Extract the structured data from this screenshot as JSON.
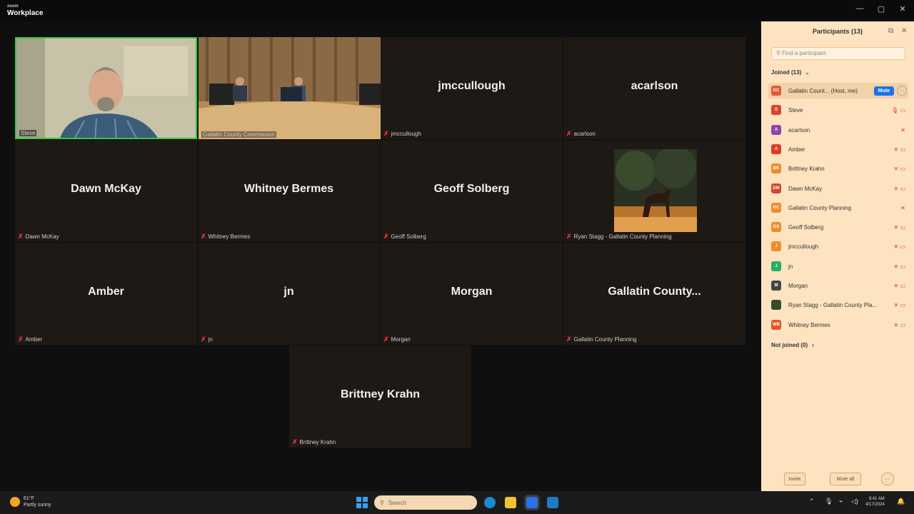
{
  "app": {
    "logo_top": "zoom",
    "logo_bottom": "Workplace"
  },
  "window_controls": {
    "minimize": "—",
    "maximize": "▢",
    "close": "✕"
  },
  "tiles": [
    {
      "name": "",
      "label": "Steve",
      "kind": "video-steve"
    },
    {
      "name": "",
      "label": "Gallatin County Commission",
      "kind": "video-room"
    },
    {
      "name": "jmccullough",
      "label": "jmccullough"
    },
    {
      "name": "acarlson",
      "label": "acarlson"
    },
    {
      "name": "Dawn McKay",
      "label": "Dawn McKay"
    },
    {
      "name": "Whitney Bermes",
      "label": "Whitney Bermes"
    },
    {
      "name": "Geoff Solberg",
      "label": "Geoff Solberg"
    },
    {
      "name": "",
      "label": "Ryan Stagg - Gallatin County Planning",
      "kind": "photo-horse"
    },
    {
      "name": "Amber",
      "label": "Amber"
    },
    {
      "name": "jn",
      "label": "jn"
    },
    {
      "name": "Morgan",
      "label": "Morgan"
    },
    {
      "name": "Gallatin County...",
      "label": "Gallatin County Planning"
    },
    {
      "name": "Brittney Krahn",
      "label": "Brittney Krahn"
    }
  ],
  "panel": {
    "title": "Participants (13)",
    "search_placeholder": "Find a participant",
    "joined_label": "Joined (13)",
    "not_joined_label": "Not joined (0)",
    "mute_label": "Mute",
    "invite_label": "Invite",
    "mute_all_label": "Mute all",
    "participants": [
      {
        "initials": "GC",
        "color": "#e05a3a",
        "name": "Gallatin Count... (Host, me)",
        "host": true
      },
      {
        "initials": "S",
        "color": "#d9452b",
        "name": "Steve",
        "icons": "🎙 ▭"
      },
      {
        "initials": "A",
        "color": "#8e44ad",
        "name": "acarlson",
        "icons": "✕"
      },
      {
        "initials": "A",
        "color": "#e03a2a",
        "name": "Amber",
        "icons": "✕ ▭"
      },
      {
        "initials": "BK",
        "color": "#f08c2a",
        "name": "Brittney Krahn",
        "icons": "✕ ▭"
      },
      {
        "initials": "DM",
        "color": "#d9452b",
        "name": "Dawn McKay",
        "icons": "✕ ▭"
      },
      {
        "initials": "GC",
        "color": "#f08c2a",
        "name": "Gallatin County Planning",
        "icons": "✕"
      },
      {
        "initials": "GS",
        "color": "#f08c2a",
        "name": "Geoff Solberg",
        "icons": "✕ ▭"
      },
      {
        "initials": "J",
        "color": "#f08c2a",
        "name": "jmccullough",
        "icons": "✕ ▭"
      },
      {
        "initials": "J",
        "color": "#27ae60",
        "name": "jn",
        "icons": "✕ ▭"
      },
      {
        "initials": "M",
        "color": "#444444",
        "name": "Morgan",
        "icons": "✕ ▭"
      },
      {
        "initials": "",
        "color": "#3b4a2a",
        "name": "Ryan Stagg - Gallatin County Pla...",
        "icons": "✕ ▭"
      },
      {
        "initials": "WB",
        "color": "#e0552a",
        "name": "Whitney Bermes",
        "icons": "✕ ▭"
      }
    ]
  },
  "taskbar": {
    "temperature": "61°F",
    "weather": "Partly sunny",
    "search_placeholder": "Search",
    "time": "9:41 AM",
    "date": "4/17/2024"
  }
}
